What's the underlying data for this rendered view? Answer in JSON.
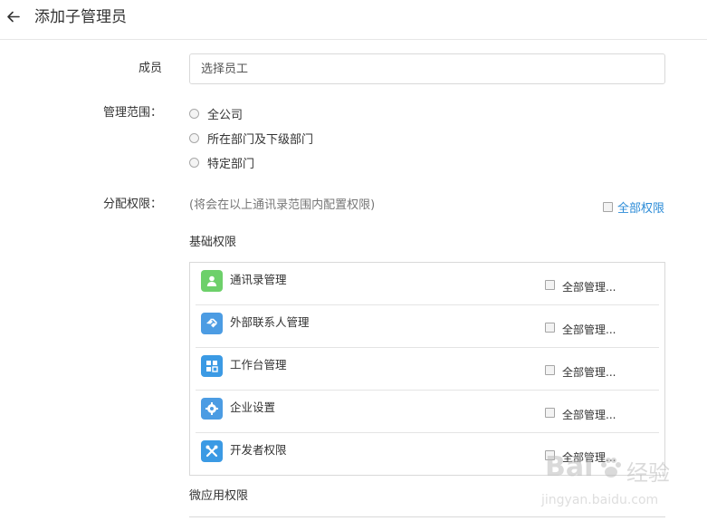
{
  "header": {
    "back_icon": "arrow-left-icon",
    "title": "添加子管理员"
  },
  "form": {
    "member": {
      "label": "成员",
      "placeholder": "选择员工"
    },
    "scope": {
      "label": "管理范围：",
      "options": [
        "全公司",
        "所在部门及下级部门",
        "特定部门"
      ]
    },
    "permissions": {
      "label": "分配权限：",
      "hint": "(将会在以上通讯录范围内配置权限)",
      "all_label": "全部权限",
      "accent_color": "#2d8cd7"
    }
  },
  "basic": {
    "title": "基础权限",
    "items": [
      {
        "name": "通讯录管理",
        "icon": "contact-person-icon",
        "color": "#6dd06a",
        "check_label": "全部管理..."
      },
      {
        "name": "外部联系人管理",
        "icon": "handshake-icon",
        "color": "#4c9ce3",
        "check_label": "全部管理..."
      },
      {
        "name": "工作台管理",
        "icon": "workbench-grid-icon",
        "color": "#3b9ae4",
        "check_label": "全部管理..."
      },
      {
        "name": "企业设置",
        "icon": "settings-gear-icon",
        "color": "#4c9ce3",
        "check_label": "全部管理..."
      },
      {
        "name": "开发者权限",
        "icon": "developer-tools-icon",
        "color": "#3b9ae4",
        "check_label": "全部管理..."
      }
    ]
  },
  "micro": {
    "title": "微应用权限"
  },
  "watermark": {
    "brand": "Bai",
    "suffix": "经验",
    "url": "jingyan.baidu.com"
  }
}
